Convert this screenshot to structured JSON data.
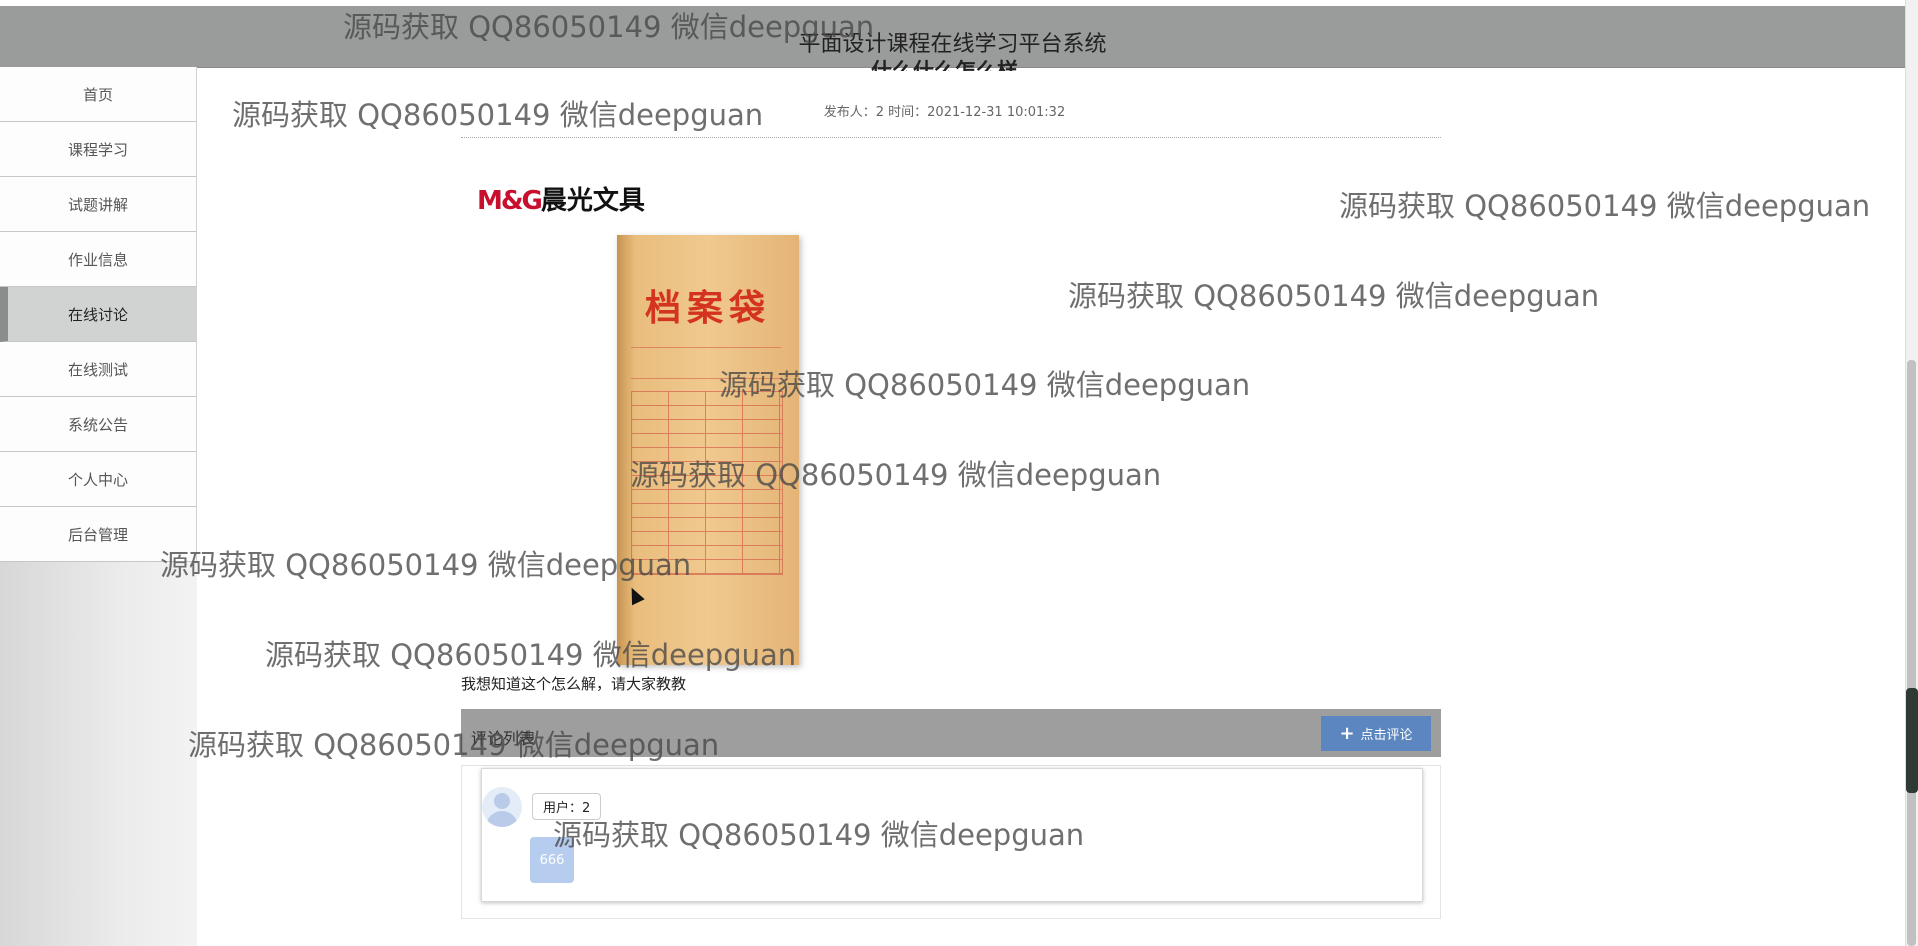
{
  "header": {
    "site_title": "平面设计课程在线学习平台系统"
  },
  "sidebar": {
    "items": [
      {
        "label": "首页"
      },
      {
        "label": "课程学习"
      },
      {
        "label": "试题讲解"
      },
      {
        "label": "作业信息"
      },
      {
        "label": "在线讨论",
        "active": true
      },
      {
        "label": "在线测试"
      },
      {
        "label": "系统公告"
      },
      {
        "label": "个人中心"
      },
      {
        "label": "后台管理"
      }
    ]
  },
  "article": {
    "title": "什么什么怎么样",
    "meta": "发布人：2  时间：2021-12-31 10:01:32",
    "image": {
      "brand_logo_mg": "M&G",
      "brand_logo_text": "晨光文具",
      "product_text": "档案袋"
    },
    "body": "我想知道这个怎么解，请大家教教"
  },
  "comments": {
    "header_label": "评论列表",
    "add_button_label": "点击评论",
    "items": [
      {
        "user": "用户：2",
        "content": "666"
      }
    ]
  },
  "watermark": {
    "text": "源码获取 QQ86050149 微信deepguan"
  },
  "colors": {
    "topbar": "#999c9a",
    "comment_button": "#5b86c0",
    "active_nav": "#d1d3d2"
  }
}
